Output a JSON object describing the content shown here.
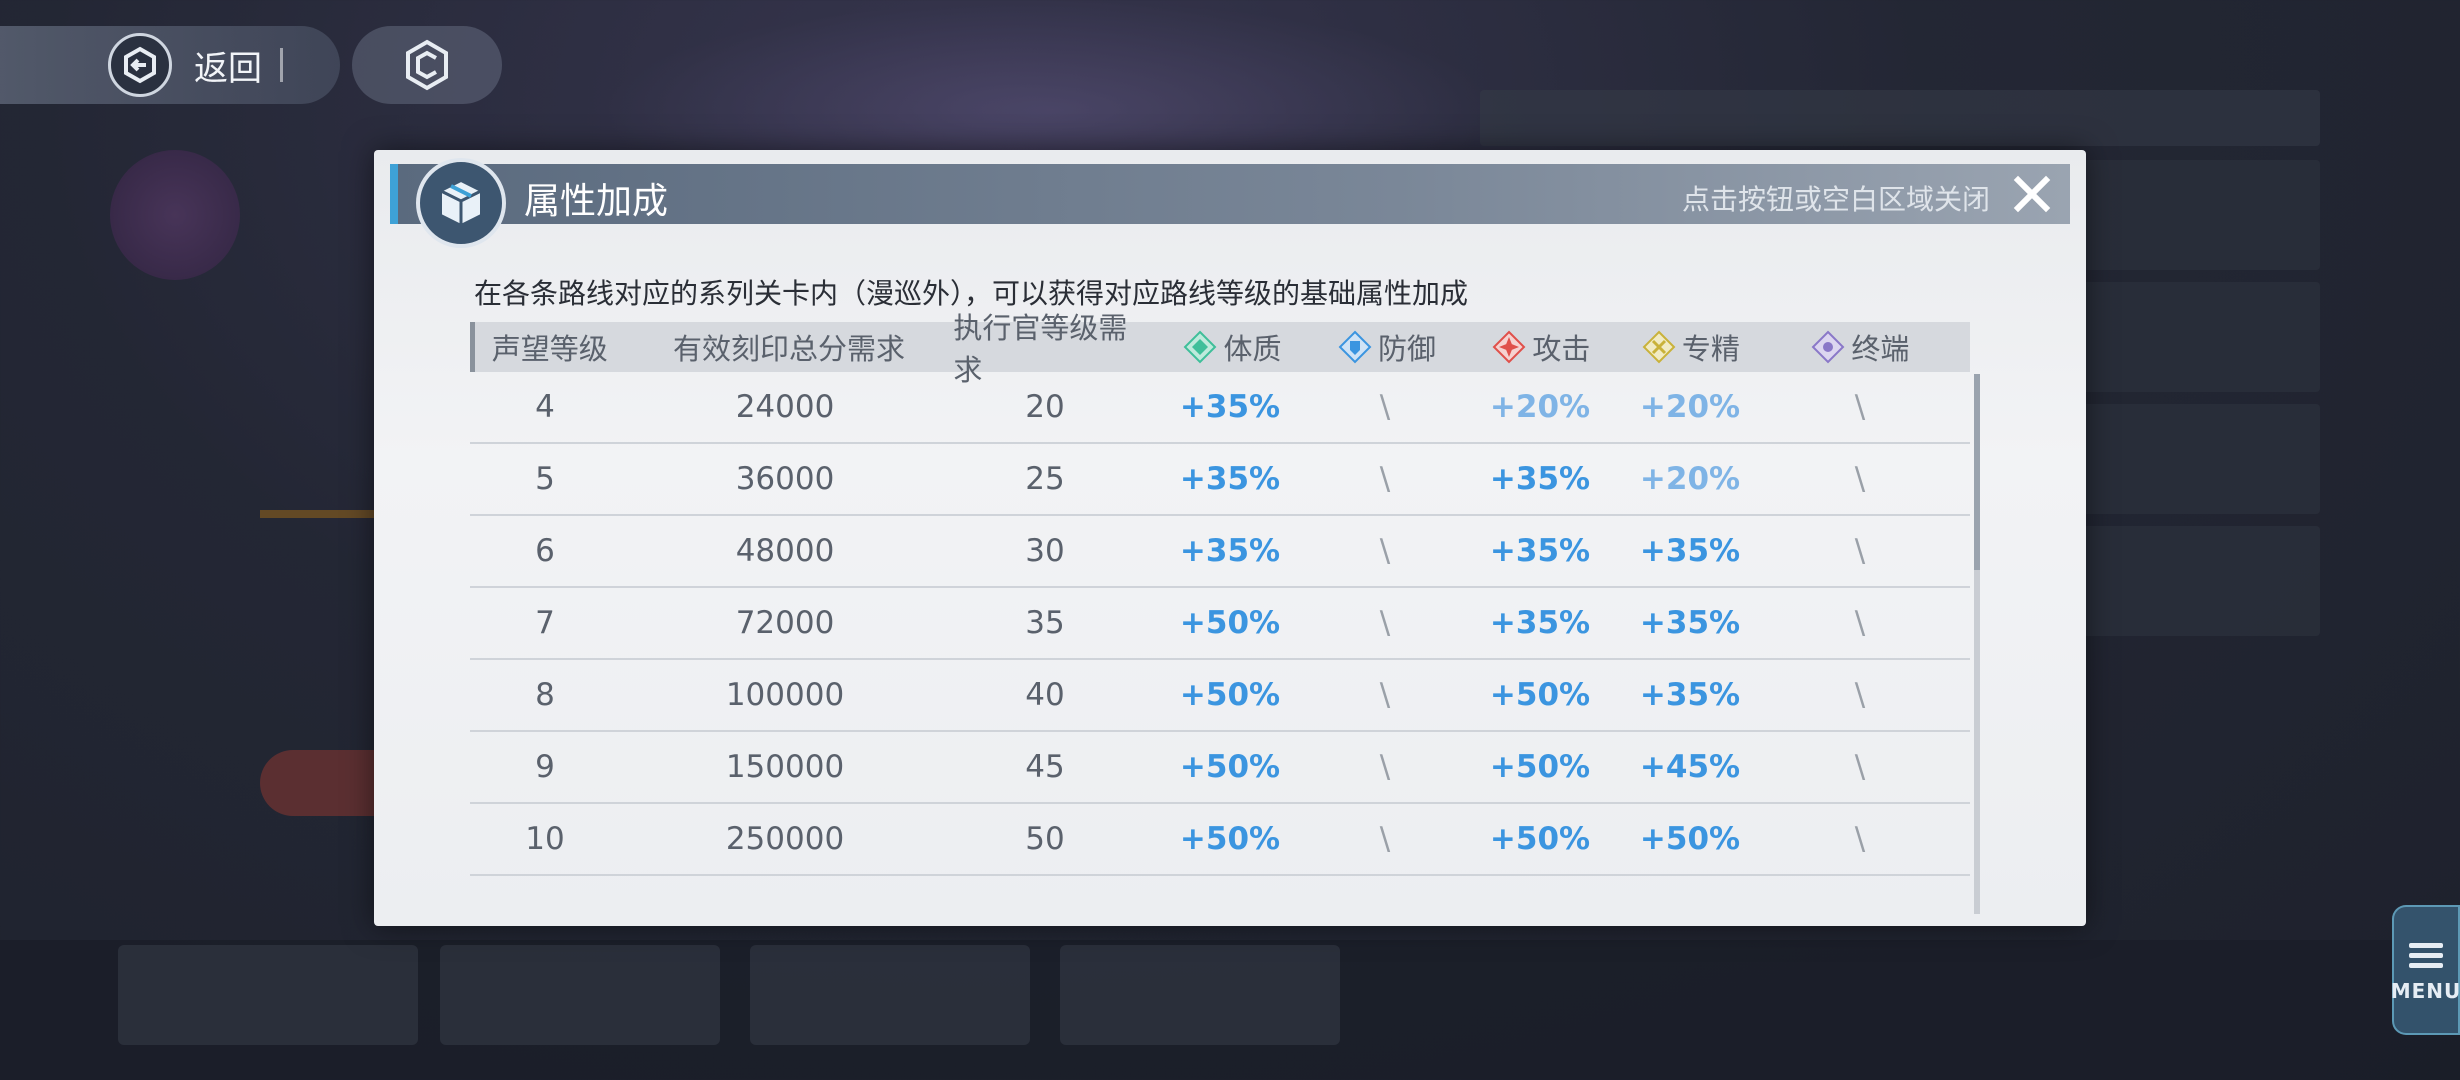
{
  "nav": {
    "back_label": "返回"
  },
  "dialog": {
    "title": "属性加成",
    "close_hint": "点击按钮或空白区域关闭",
    "description": "在各条路线对应的系列关卡内（漫巡外），可以获得对应路线等级的基础属性加成"
  },
  "table": {
    "headers": [
      {
        "label": "声望等级"
      },
      {
        "label": "有效刻印总分需求"
      },
      {
        "label": "执行官等级需求"
      },
      {
        "label": "体质",
        "icon": "constitution-icon",
        "color": "#3fbf9a"
      },
      {
        "label": "防御",
        "icon": "defense-icon",
        "color": "#3b95e0"
      },
      {
        "label": "攻击",
        "icon": "attack-icon",
        "color": "#e0504a"
      },
      {
        "label": "专精",
        "icon": "mastery-icon",
        "color": "#c9b23a"
      },
      {
        "label": "终端",
        "icon": "terminal-icon",
        "color": "#8a78c8"
      }
    ],
    "rows": [
      [
        "4",
        "24000",
        "20",
        "+35%",
        "\\",
        "+20%",
        "+20%",
        "\\"
      ],
      [
        "5",
        "36000",
        "25",
        "+35%",
        "\\",
        "+35%",
        "+20%",
        "\\"
      ],
      [
        "6",
        "48000",
        "30",
        "+35%",
        "\\",
        "+35%",
        "+35%",
        "\\"
      ],
      [
        "7",
        "72000",
        "35",
        "+50%",
        "\\",
        "+35%",
        "+35%",
        "\\"
      ],
      [
        "8",
        "100000",
        "40",
        "+50%",
        "\\",
        "+50%",
        "+35%",
        "\\"
      ],
      [
        "9",
        "150000",
        "45",
        "+50%",
        "\\",
        "+50%",
        "+45%",
        "\\"
      ],
      [
        "10",
        "250000",
        "50",
        "+50%",
        "\\",
        "+50%",
        "+50%",
        "\\"
      ]
    ]
  },
  "menu": {
    "label": "MENU"
  },
  "colors": {
    "accent": "#3ea1d6",
    "value_blue": "#3b95e0",
    "value_light_blue": "#7fb4e6"
  }
}
